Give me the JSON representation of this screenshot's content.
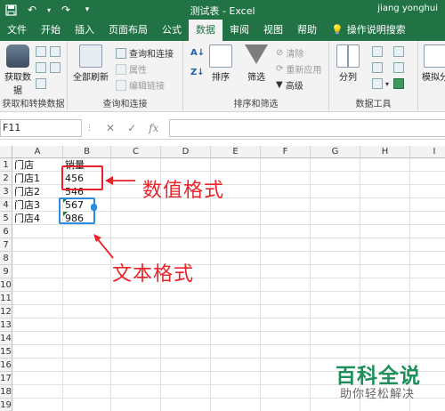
{
  "titlebar": {
    "doc_title": "测试表 - Excel",
    "user": "jiang yonghui"
  },
  "tabs": [
    {
      "label": "文件"
    },
    {
      "label": "开始"
    },
    {
      "label": "插入"
    },
    {
      "label": "页面布局"
    },
    {
      "label": "公式"
    },
    {
      "label": "数据",
      "active": true
    },
    {
      "label": "审阅"
    },
    {
      "label": "视图"
    },
    {
      "label": "帮助"
    },
    {
      "label": "操作说明搜索"
    }
  ],
  "ribbon": {
    "get_data": "获取数据",
    "get_data_line1": "获取数",
    "get_data_line2": "据",
    "group_get_transform": "获取和转换数据",
    "refresh_all": "全部刷新",
    "queries_connections": "查询和连接",
    "properties": "属性",
    "edit_links": "编辑链接",
    "group_queries": "查询和连接",
    "sort": "排序",
    "filter": "筛选",
    "clear": "清除",
    "reapply": "重新应用",
    "advanced": "高级",
    "group_sort_filter": "排序和筛选",
    "text_to_columns": "分列",
    "group_data_tools": "数据工具",
    "what_if": "模拟分"
  },
  "formula_bar": {
    "name_box": "F11",
    "cancel": "✕",
    "confirm": "✓",
    "fx": "fx",
    "value": ""
  },
  "columns": [
    "A",
    "B",
    "C",
    "D",
    "E",
    "F",
    "G",
    "H",
    "I"
  ],
  "rows": [
    "1",
    "2",
    "3",
    "4",
    "5",
    "6",
    "7",
    "8",
    "9",
    "10",
    "11",
    "12",
    "13",
    "14",
    "15",
    "16",
    "17",
    "18",
    "19"
  ],
  "cells": {
    "A1": "门店",
    "B1": "销量",
    "A2": "门店1",
    "B2": "456",
    "A3": "门店2",
    "B3": "546",
    "A4": "门店3",
    "B4": "567",
    "A5": "门店4",
    "B5": "986"
  },
  "annotations": {
    "numeric_format": "数值格式",
    "text_format": "文本格式"
  },
  "colors": {
    "excel_green": "#217346",
    "annotation_red": "#e8232a",
    "selection_blue": "#2b8cdd"
  },
  "watermark": {
    "brand": "百科全说",
    "tagline": "助你轻松解决"
  }
}
